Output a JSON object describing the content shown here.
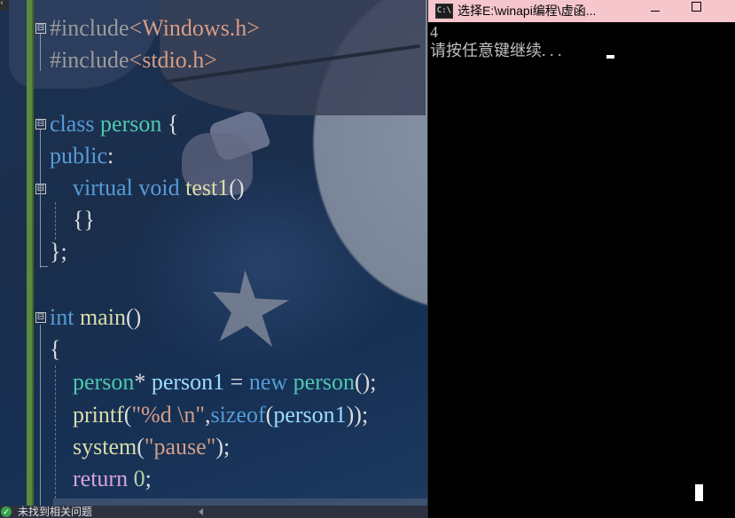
{
  "editor": {
    "code_lines": [
      {
        "parts": [
          {
            "t": "#include",
            "c": "pre"
          },
          {
            "t": "<Windows.h>",
            "c": "inc"
          }
        ]
      },
      {
        "parts": [
          {
            "t": "#include",
            "c": "pre"
          },
          {
            "t": "<stdio.h>",
            "c": "inc"
          }
        ]
      },
      {
        "parts": []
      },
      {
        "parts": [
          {
            "t": "class",
            "c": "kw"
          },
          {
            "t": " ",
            "c": "pl"
          },
          {
            "t": "person",
            "c": "ty"
          },
          {
            "t": " {",
            "c": "pl"
          }
        ]
      },
      {
        "parts": [
          {
            "t": "public",
            "c": "kw"
          },
          {
            "t": ":",
            "c": "pl"
          }
        ]
      },
      {
        "parts": [
          {
            "t": "    ",
            "c": "pl"
          },
          {
            "t": "virtual",
            "c": "kw"
          },
          {
            "t": " ",
            "c": "pl"
          },
          {
            "t": "void",
            "c": "kw"
          },
          {
            "t": " ",
            "c": "pl"
          },
          {
            "t": "test1",
            "c": "fn"
          },
          {
            "t": "()",
            "c": "pl"
          }
        ]
      },
      {
        "parts": [
          {
            "t": "    {}",
            "c": "pl"
          }
        ]
      },
      {
        "parts": [
          {
            "t": "};",
            "c": "pl"
          }
        ]
      },
      {
        "parts": []
      },
      {
        "parts": [
          {
            "t": "int",
            "c": "kw"
          },
          {
            "t": " ",
            "c": "pl"
          },
          {
            "t": "main",
            "c": "fn"
          },
          {
            "t": "()",
            "c": "pl"
          }
        ]
      },
      {
        "parts": [
          {
            "t": "{",
            "c": "pl"
          }
        ]
      },
      {
        "parts": [
          {
            "t": "    ",
            "c": "pl"
          },
          {
            "t": "person",
            "c": "ty"
          },
          {
            "t": "* ",
            "c": "pl"
          },
          {
            "t": "person1",
            "c": "var"
          },
          {
            "t": " = ",
            "c": "pl"
          },
          {
            "t": "new",
            "c": "kw"
          },
          {
            "t": " ",
            "c": "pl"
          },
          {
            "t": "person",
            "c": "ty"
          },
          {
            "t": "();",
            "c": "pl"
          }
        ]
      },
      {
        "parts": [
          {
            "t": "    ",
            "c": "pl"
          },
          {
            "t": "printf",
            "c": "fn"
          },
          {
            "t": "(",
            "c": "pl"
          },
          {
            "t": "\"%d \\n\"",
            "c": "str"
          },
          {
            "t": ",",
            "c": "pl"
          },
          {
            "t": "sizeof",
            "c": "kw"
          },
          {
            "t": "(",
            "c": "pl"
          },
          {
            "t": "person1",
            "c": "var"
          },
          {
            "t": "));",
            "c": "pl"
          }
        ]
      },
      {
        "parts": [
          {
            "t": "    ",
            "c": "pl"
          },
          {
            "t": "system",
            "c": "fn"
          },
          {
            "t": "(",
            "c": "pl"
          },
          {
            "t": "\"pause\"",
            "c": "str"
          },
          {
            "t": ");",
            "c": "pl"
          }
        ]
      },
      {
        "parts": [
          {
            "t": "    ",
            "c": "pl"
          },
          {
            "t": "return",
            "c": "ctl"
          },
          {
            "t": " ",
            "c": "pl"
          },
          {
            "t": "0",
            "c": "num"
          },
          {
            "t": ";",
            "c": "pl"
          }
        ]
      }
    ],
    "fold_markers": [
      "⊟",
      "⊟",
      "⊟",
      "⊟"
    ],
    "status": {
      "icon": "check-circle-icon",
      "ok_glyph": "✓",
      "message": "未找到相关问题"
    },
    "corner_glyph": "‹"
  },
  "console": {
    "title": "选择E:\\winapi编程\\虚函...",
    "app_icon_label": "C:\\",
    "output_lines": [
      "4",
      "请按任意键继续. . ."
    ]
  },
  "colors": {
    "keyword": "#569cd6",
    "type": "#4ec9b0",
    "function": "#dcdcaa",
    "string": "#d69d85",
    "titlebar": "#f6c6cd",
    "console_bg": "#000000"
  }
}
